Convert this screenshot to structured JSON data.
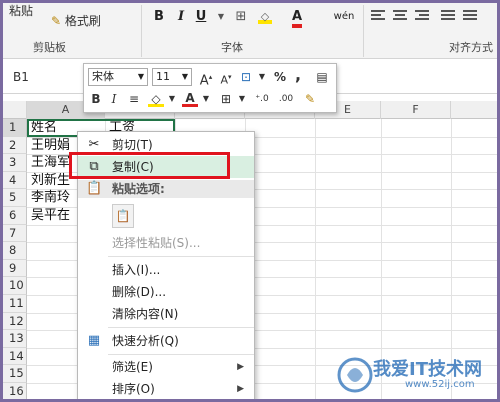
{
  "ribbon": {
    "paste_label": "粘贴",
    "format_painter_label": "格式刷",
    "clipboard_group": "剪贴板",
    "font_group": "字体",
    "alignment_group": "对齐方式",
    "bold": "B",
    "italic": "I",
    "underline": "U",
    "wen": "wén"
  },
  "formula_bar": {
    "name_box": "B1"
  },
  "mini_toolbar": {
    "font_name": "宋体",
    "font_size": "11",
    "bold": "B",
    "italic": "I",
    "percent": "%",
    "comma": ","
  },
  "columns": [
    "A",
    "E",
    "F"
  ],
  "rows": [
    "1",
    "2",
    "3",
    "4",
    "5",
    "6",
    "7",
    "8",
    "9",
    "10",
    "11",
    "12",
    "13",
    "14",
    "15",
    "16"
  ],
  "cells": {
    "a1": "姓名",
    "a2": "王明娟",
    "a3": "王海军",
    "a4": "刘新生",
    "a5": "李南玲",
    "a6": "吴平在",
    "b1": "工资"
  },
  "context_menu": {
    "cut": "剪切(T)",
    "copy": "复制(C)",
    "paste_options": "粘贴选项:",
    "paste_special": "选择性粘贴(S)...",
    "insert": "插入(I)...",
    "delete": "删除(D)...",
    "clear_contents": "清除内容(N)",
    "quick_analysis": "快速分析(Q)",
    "filter": "筛选(E)",
    "sort": "排序(O)"
  },
  "watermark": {
    "title": "我爱IT技术网",
    "url": "www.52ij.com"
  },
  "colors": {
    "highlight_red": "#e0141e",
    "menu_hover": "#d9efe1",
    "watermark_blue": "#2a6fb8"
  }
}
